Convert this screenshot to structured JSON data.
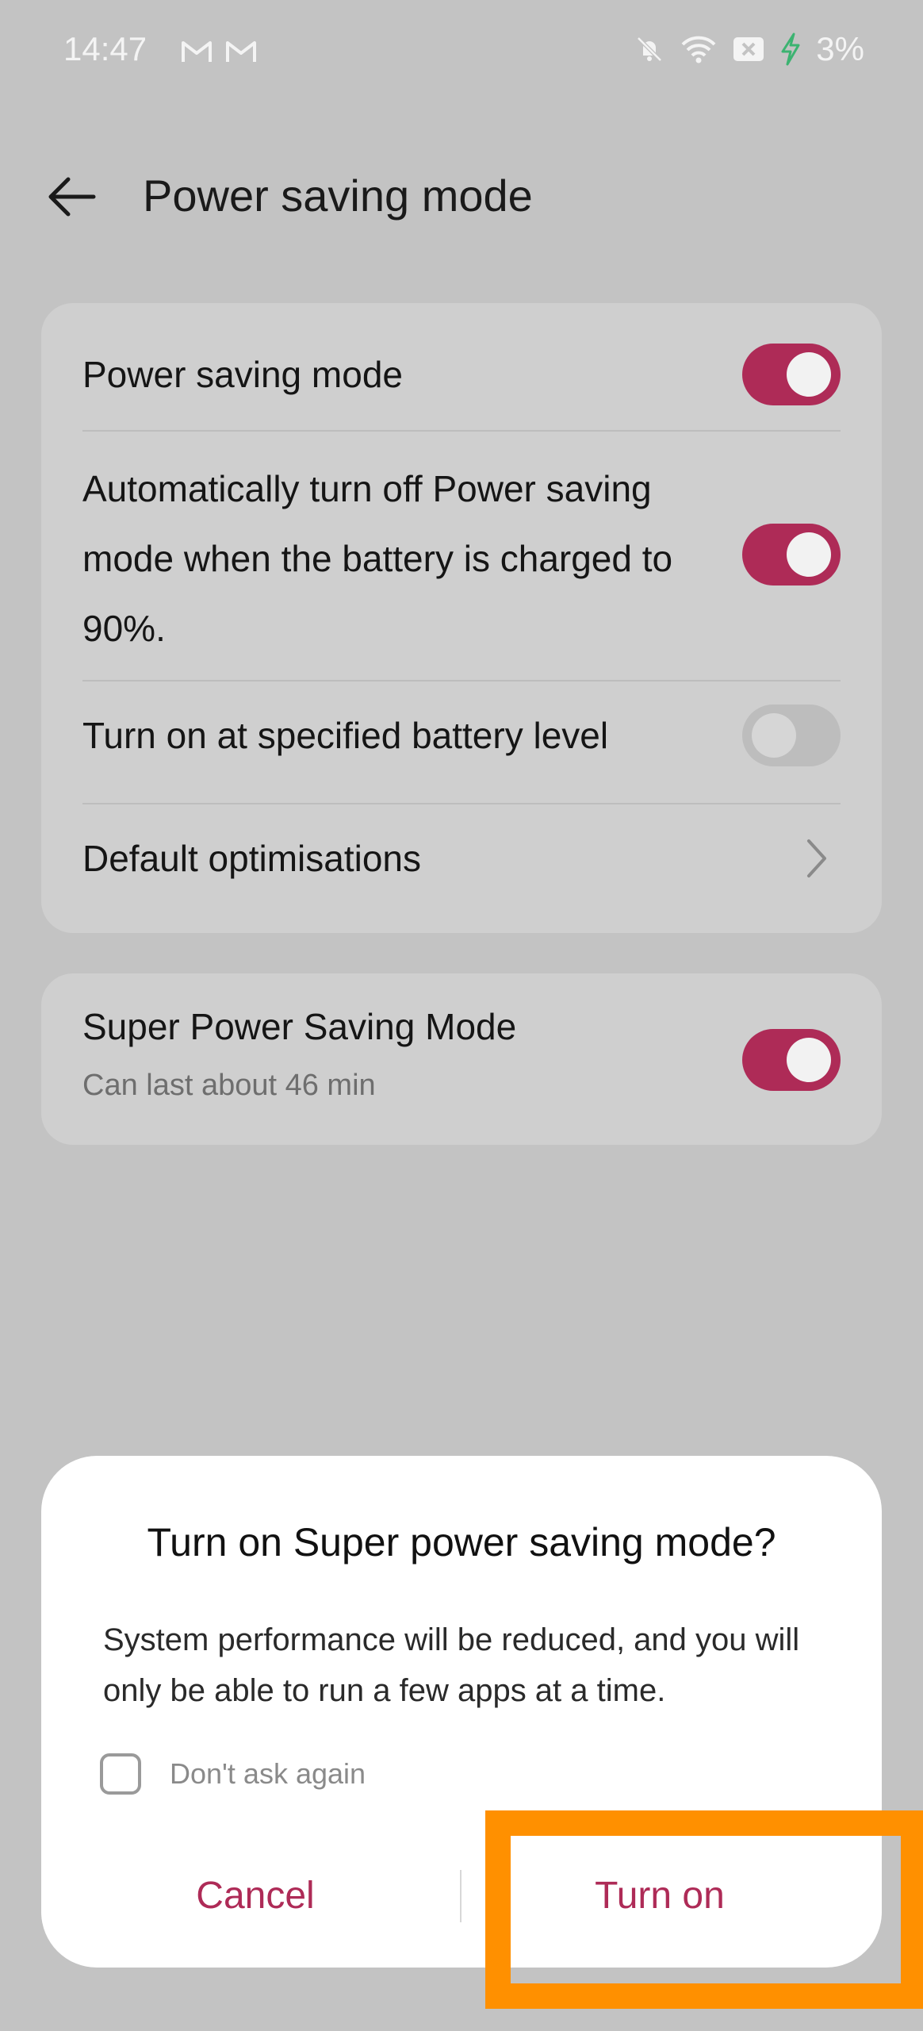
{
  "status_bar": {
    "time": "14:47",
    "notifications": [
      "gmail-icon",
      "gmail-icon"
    ],
    "icons": [
      "bell-off-icon",
      "wifi-icon",
      "battery-saver-icon",
      "charging-bolt-icon"
    ],
    "battery": "3%"
  },
  "header": {
    "title": "Power saving mode",
    "back_icon": "arrow-left-icon"
  },
  "settings": {
    "power_saving_mode": {
      "label": "Power saving mode",
      "on": true
    },
    "auto_turn_off": {
      "label": "Automatically turn off Power saving mode when the battery is charged to 90%.",
      "on": true
    },
    "turn_on_at_level": {
      "label": "Turn on at specified battery level",
      "on": false
    },
    "default_optimisations": {
      "label": "Default optimisations"
    },
    "super_power_saving": {
      "label": "Super Power Saving Mode",
      "sublabel": "Can last about 46 min",
      "on": true
    }
  },
  "dialog": {
    "title": "Turn on Super power saving mode?",
    "message": "System performance will be reduced, and you will only be able to run a few apps at a time.",
    "checkbox_label": "Don't ask again",
    "checkbox_checked": false,
    "cancel_label": "Cancel",
    "confirm_label": "Turn on"
  },
  "colors": {
    "accent": "#ae2b57",
    "highlight": "#ff9000",
    "background": "#c3c3c3",
    "card": "#cfcfcf"
  }
}
